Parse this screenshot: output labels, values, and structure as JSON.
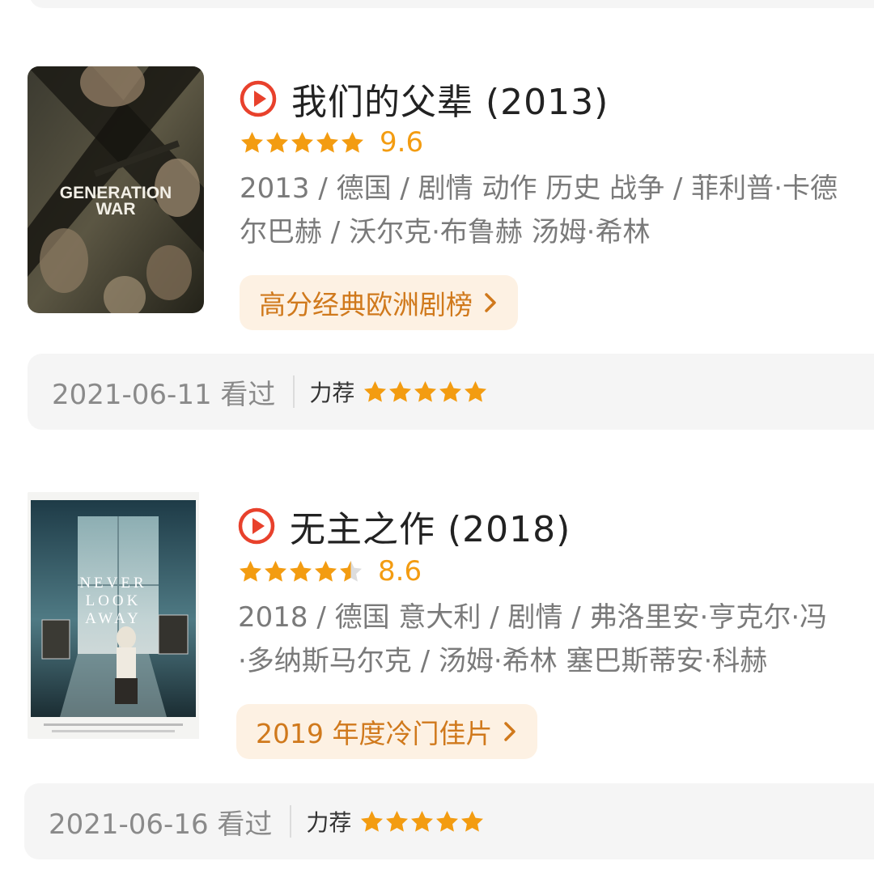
{
  "entries": [
    {
      "title": "我们的父辈 (2013)",
      "stars": [
        1,
        1,
        1,
        1,
        1
      ],
      "score": "9.6",
      "meta_line1": "2013 / 德国 / 剧情 动作 历史 战争 / 菲利普·卡德",
      "meta_line2": "尔巴赫 / 沃尔克·布鲁赫 汤姆·希林",
      "tag": "高分经典欧洲剧榜",
      "watched": "2021-06-11 看过",
      "recommend": "力荐",
      "user_stars": [
        1,
        1,
        1,
        1,
        1
      ],
      "poster": {
        "title_line1": "GENERATION",
        "title_line2": "WAR"
      }
    },
    {
      "title": "无主之作 (2018)",
      "stars": [
        1,
        1,
        1,
        1,
        0.5
      ],
      "score": "8.6",
      "meta_line1": "2018 / 德国 意大利 / 剧情 / 弗洛里安·亨克尔·冯",
      "meta_line2": "·多纳斯马尔克 / 汤姆·希林 塞巴斯蒂安·科赫",
      "tag": "2019 年度冷门佳片",
      "watched": "2021-06-16 看过",
      "recommend": "力荐",
      "user_stars": [
        1,
        1,
        1,
        1,
        1
      ],
      "poster": {
        "title_line1": "NEVER",
        "title_line2": "LOOK",
        "title_line3": "AWAY"
      }
    }
  ],
  "colors": {
    "star": "#f39c11",
    "play_icon": "#e8412c",
    "tag_bg": "#fdf1e3",
    "tag_text": "#d0791c"
  }
}
